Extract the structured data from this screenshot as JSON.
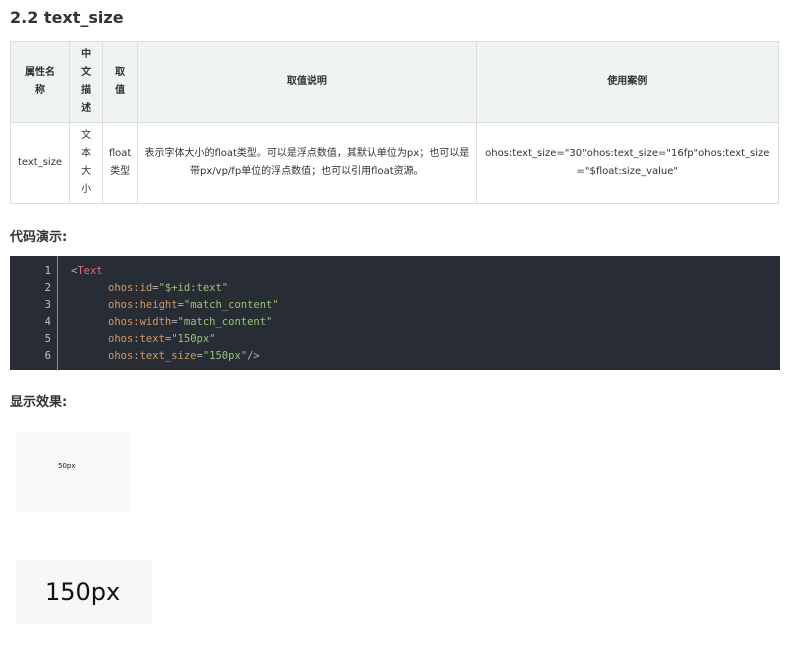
{
  "section": {
    "title": "2.2 text_size"
  },
  "table": {
    "headers": [
      "属性名称",
      "中文描述",
      "取值",
      "取值说明",
      "使用案例"
    ],
    "row": {
      "name": "text_size",
      "desc": "文本大小",
      "value": "float类型",
      "explain": "表示字体大小的float类型。可以是浮点数值，其默认单位为px；也可以是带px/vp/fp单位的浮点数值；也可以引用float资源。",
      "example": "ohos:text_size=\"30\"ohos:text_size=\"16fp\"ohos:text_size=\"$float:size_value\""
    }
  },
  "code_label": "代码演示:",
  "code": {
    "line_numbers": [
      "1",
      "2",
      "3",
      "4",
      "5",
      "6"
    ],
    "l1": {
      "open": "<",
      "tag": "Text"
    },
    "l2": {
      "attr": "ohos:id",
      "eq": "=",
      "val": "\"$+id:text\""
    },
    "l3": {
      "attr": "ohos:height",
      "eq": "=",
      "val": "\"match_content\""
    },
    "l4": {
      "attr": "ohos:width",
      "eq": "=",
      "val": "\"match_content\""
    },
    "l5": {
      "attr": "ohos:text",
      "eq": "=",
      "val": "\"150px\""
    },
    "l6": {
      "attr": "ohos:text_size",
      "eq": "=",
      "val": "\"150px\"",
      "close": "/>"
    }
  },
  "result_label": "显示效果:",
  "demo": {
    "small": "50px",
    "large": "150px"
  }
}
